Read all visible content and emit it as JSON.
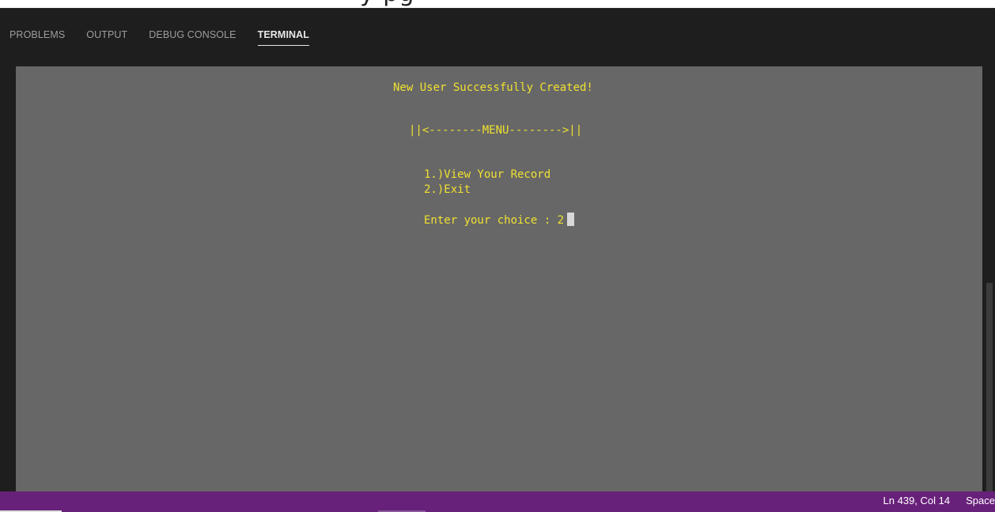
{
  "top_banner": {
    "cropped_text": "y         pg"
  },
  "panel": {
    "tabs": [
      {
        "label": "PROBLEMS",
        "active": false
      },
      {
        "label": "OUTPUT",
        "active": false
      },
      {
        "label": "DEBUG CONSOLE",
        "active": false
      },
      {
        "label": "TERMINAL",
        "active": true
      }
    ]
  },
  "terminal": {
    "text_color": "#f0e130",
    "background": "#676767",
    "lines": {
      "success": "New User Successfully Created!",
      "menu_header": "||<--------MENU-------->||",
      "option_1": "1.)View Your Record",
      "option_2": "2.)Exit",
      "prompt": "Enter your choice : 2"
    }
  },
  "status_bar": {
    "background": "#68217a",
    "position": "Ln 439, Col 14",
    "spaces": "Space"
  }
}
